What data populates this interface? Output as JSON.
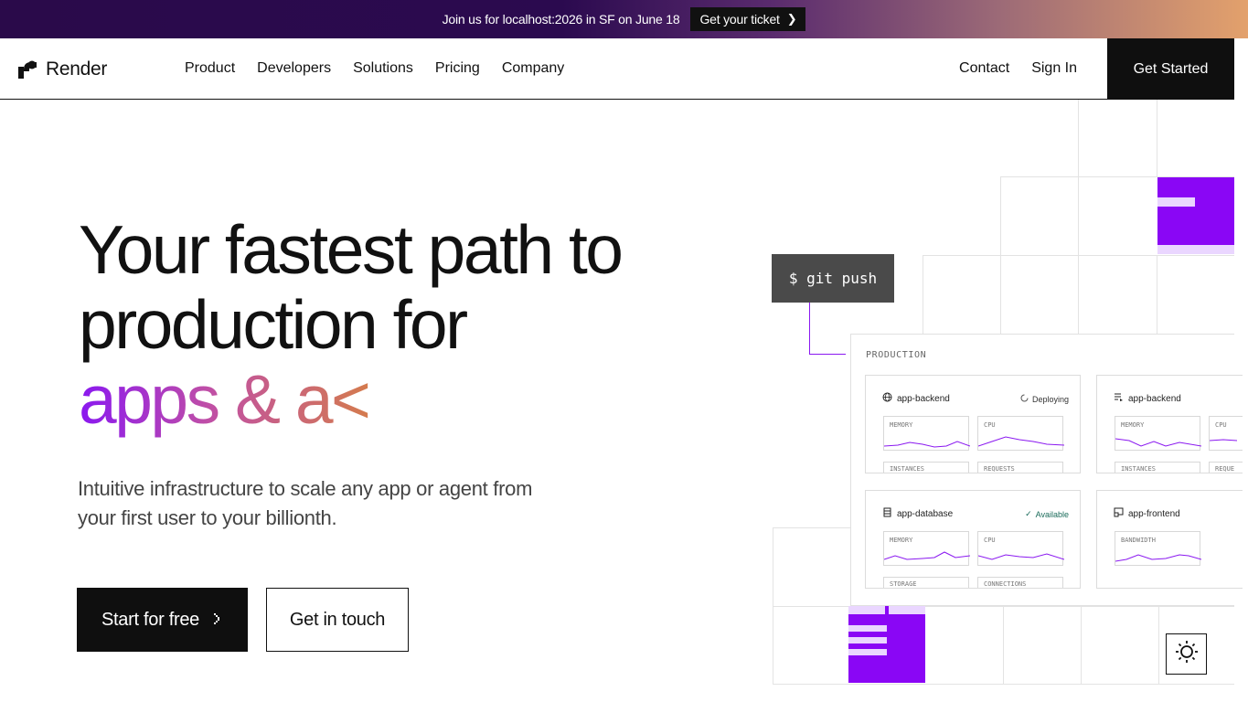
{
  "announcement": {
    "text": "Join us for localhost:2026 in SF on June 18",
    "cta": "Get your ticket"
  },
  "header": {
    "brand": "Render",
    "nav": [
      "Product",
      "Developers",
      "Solutions",
      "Pricing",
      "Company"
    ],
    "contact": "Contact",
    "signin": "Sign In",
    "get_started": "Get Started"
  },
  "hero": {
    "line1": "Your fastest path to",
    "line2": "production for",
    "line3": "apps & a<",
    "subtitle": "Intuitive infrastructure to scale any app or agent from your first user to your billionth.",
    "primary_cta": "Start for free",
    "secondary_cta": "Get in touch"
  },
  "illustration": {
    "terminal": "$ git push",
    "panel_title": "PRODUCTION",
    "cards": [
      {
        "name": "app-backend",
        "status": "Deploying",
        "metrics": [
          "MEMORY",
          "CPU"
        ],
        "footer": [
          "INSTANCES",
          "REQUESTS"
        ]
      },
      {
        "name": "app-backend",
        "status": "",
        "metrics": [
          "MEMORY",
          "CPU"
        ],
        "footer": [
          "INSTANCES",
          "REQUE"
        ]
      },
      {
        "name": "app-database",
        "status": "Available",
        "metrics": [
          "MEMORY",
          "CPU"
        ],
        "footer": [
          "STORAGE",
          "CONNECTIONS"
        ]
      },
      {
        "name": "app-frontend",
        "status": "",
        "metrics": [
          "BANDWIDTH"
        ],
        "footer": []
      }
    ]
  },
  "colors": {
    "accent": "#8a06f5",
    "dark": "#0f0f0f",
    "available": "#1a6b5a"
  },
  "icons": {
    "theme_toggle": "sun-icon"
  }
}
